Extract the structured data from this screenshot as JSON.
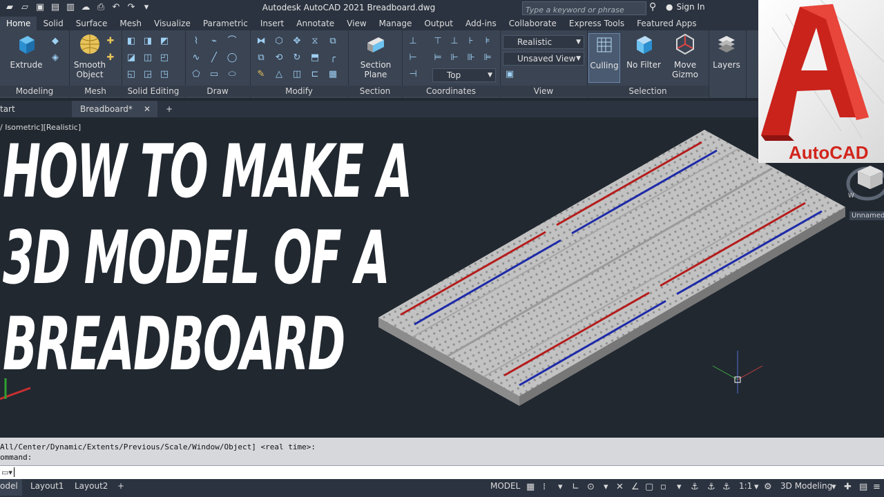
{
  "app": {
    "title": "Autodesk AutoCAD 2021    Breadboard.dwg",
    "search_placeholder": "Type a keyword or phrase",
    "sign_in": "Sign In"
  },
  "ribbon_tabs": [
    "Home",
    "Solid",
    "Surface",
    "Mesh",
    "Visualize",
    "Parametric",
    "Insert",
    "Annotate",
    "View",
    "Manage",
    "Output",
    "Add-ins",
    "Collaborate",
    "Express Tools",
    "Featured Apps"
  ],
  "panels": {
    "modeling": "Modeling",
    "mesh": "Mesh",
    "solid_editing": "Solid Editing",
    "draw": "Draw",
    "modify": "Modify",
    "section": "Section",
    "coordinates": "Coordinates",
    "view": "View",
    "selection": "Selection"
  },
  "buttons": {
    "extrude": "Extrude",
    "smooth_object_1": "Smooth",
    "smooth_object_2": "Object",
    "section_plane_1": "Section",
    "section_plane_2": "Plane",
    "culling": "Culling",
    "no_filter": "No Filter",
    "move_gizmo_1": "Move",
    "move_gizmo_2": "Gizmo",
    "layers": "Layers"
  },
  "dropdowns": {
    "visual_style": "Realistic",
    "named_view": "Unsaved View",
    "view_direction": "Top"
  },
  "file_tabs": {
    "start": "tart",
    "breadboard": "Breadboard*"
  },
  "viewport": {
    "label": "/ Isometric][Realistic]",
    "viewcube_label": "Unnamed",
    "compass_w": "W"
  },
  "headline": [
    "HOW TO MAKE A",
    "3D MODEL OF A",
    "BREADBOARD"
  ],
  "logo": {
    "text": "AutoCAD",
    "accent_color": "#d2251c"
  },
  "command": {
    "history_line": "All/Center/Dynamic/Extents/Previous/Scale/Window/Object] <real time>:",
    "prompt": "ommand:"
  },
  "layout_tabs": [
    "odel",
    "Layout1",
    "Layout2"
  ],
  "status_bar": {
    "model": "MODEL",
    "scale": "1:1",
    "workspace": "3D Modeling"
  },
  "colors": {
    "rail_red": "#b51c1c",
    "rail_blue": "#1d2aa8",
    "board": "#c9c9c9",
    "accent": "#5aa0d6"
  }
}
